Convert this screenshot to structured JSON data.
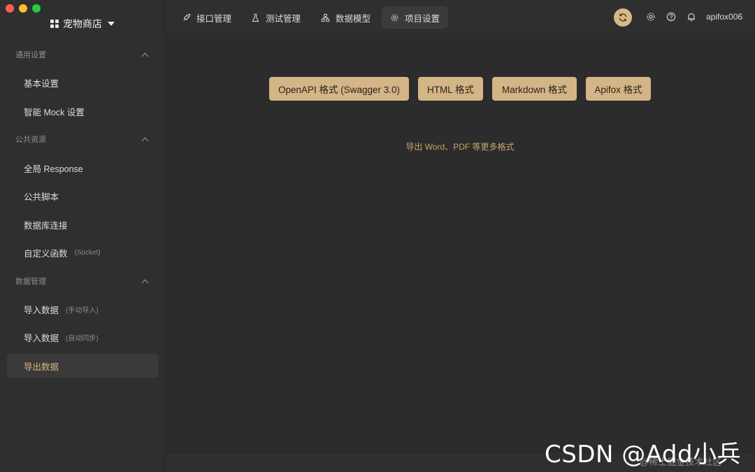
{
  "window": {
    "traffic_lights": [
      "close",
      "minimize",
      "zoom"
    ],
    "colors": {
      "close": "#fe5f57",
      "minimize": "#febc2e",
      "zoom": "#28c840"
    }
  },
  "project": {
    "name": "宠物商店",
    "icon": "grid-icon"
  },
  "sidebar": {
    "groups": [
      {
        "title": "通用设置",
        "items": [
          {
            "label": "基本设置"
          },
          {
            "label": "智能 Mock 设置"
          }
        ]
      },
      {
        "title": "公共资源",
        "items": [
          {
            "label": "全局 Response"
          },
          {
            "label": "公共脚本"
          },
          {
            "label": "数据库连接"
          },
          {
            "label": "自定义函数",
            "sub": "(Socket)"
          }
        ]
      },
      {
        "title": "数据管理",
        "items": [
          {
            "label": "导入数据",
            "sub": "(手动导入)"
          },
          {
            "label": "导入数据",
            "sub": "(自动同步)"
          },
          {
            "label": "导出数据",
            "active": true
          }
        ]
      }
    ]
  },
  "tabs": [
    {
      "label": "接口管理",
      "icon": "rocket-icon"
    },
    {
      "label": "测试管理",
      "icon": "flask-icon"
    },
    {
      "label": "数据模型",
      "icon": "model-icon"
    },
    {
      "label": "项目设置",
      "icon": "gear-icon",
      "active": true
    }
  ],
  "header": {
    "user": "apifox006",
    "icons": [
      "sync-icon",
      "settings-icon",
      "help-icon",
      "bell-icon"
    ],
    "accent": "#d9b884"
  },
  "export": {
    "formats": [
      "OpenAPI 格式 (Swagger 3.0)",
      "HTML 格式",
      "Markdown 格式",
      "Apifox 格式"
    ],
    "more_link": "导出 Word、PDF 等更多格式"
  },
  "watermark": {
    "main": "CSDN @Add小兵",
    "sub": "@稀土掘金技术社区"
  },
  "theme": {
    "button_bg": "#d4b587",
    "link_color": "#c9a36a",
    "active_text": "#d8b57e"
  }
}
